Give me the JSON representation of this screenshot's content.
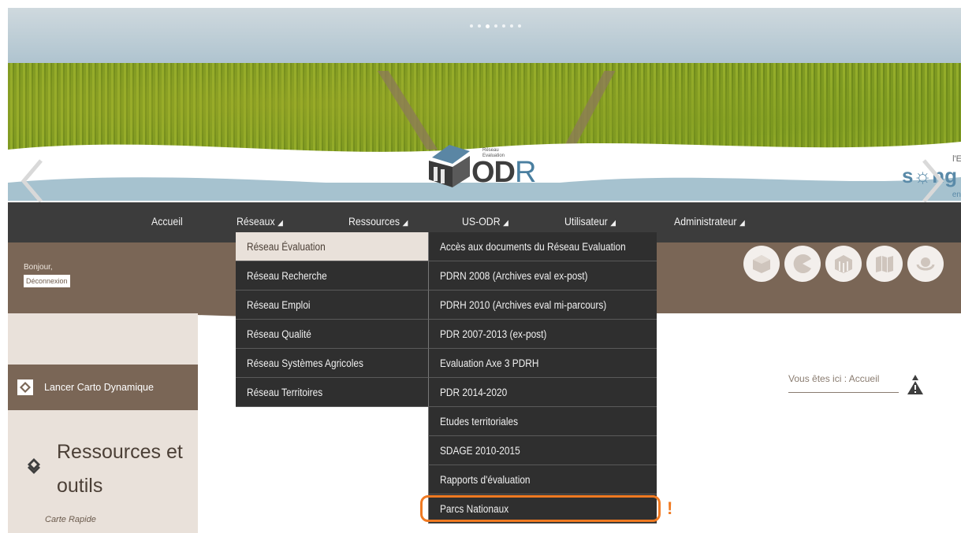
{
  "banner": {
    "slide_dots": 7,
    "active_dot": 3,
    "logo": {
      "small_line1": "Réseau",
      "small_line2": "Evaluation",
      "od": "OD",
      "r": "R"
    },
    "partner": {
      "top": "l'E",
      "main": "s☼ng",
      "sub": "en"
    }
  },
  "nav": {
    "items": [
      {
        "label": "Accueil",
        "caret": ""
      },
      {
        "label": "Réseaux",
        "caret": "◢"
      },
      {
        "label": "Ressources",
        "caret": "◢"
      },
      {
        "label": "US-ODR",
        "caret": "◢"
      },
      {
        "label": "Utilisateur",
        "caret": "◢"
      },
      {
        "label": "Administrateur",
        "caret": "◢"
      }
    ]
  },
  "user": {
    "greeting": "Bonjour,",
    "logout": "Déconnexion"
  },
  "quick_icons": [
    "box-icon",
    "pie-icon",
    "crate-icon",
    "map-icon",
    "globe-hands-icon"
  ],
  "sidebar": {
    "carto_label": "Lancer Carto Dynamique",
    "resources_title_line1": "Ressources et",
    "resources_title_line2": "outils",
    "carte_rapide": "Carte Rapide"
  },
  "breadcrumb": {
    "prefix": "Vous êtes ici :",
    "current": "Accueil"
  },
  "menus": {
    "reseaux": [
      {
        "label": "Réseau Évaluation",
        "active": true
      },
      {
        "label": "Réseau Recherche"
      },
      {
        "label": "Réseau Emploi"
      },
      {
        "label": "Réseau Qualité"
      },
      {
        "label": "Réseau Systèmes Agricoles"
      },
      {
        "label": "Réseau Territoires"
      }
    ],
    "usodr": [
      {
        "label": "Accès aux documents du Réseau Evaluation"
      },
      {
        "label": "PDRN 2008 (Archives eval ex-post)"
      },
      {
        "label": "PDRH 2010 (Archives eval mi-parcours)"
      },
      {
        "label": "PDR 2007-2013 (ex-post)"
      },
      {
        "label": "Evaluation Axe 3 PDRH"
      },
      {
        "label": "PDR 2014-2020"
      },
      {
        "label": "Etudes territoriales"
      },
      {
        "label": "SDAGE 2010-2015"
      },
      {
        "label": "Rapports d'évaluation"
      },
      {
        "label": "Parcs Nationaux"
      }
    ]
  },
  "annotation": {
    "mark": "!",
    "color": "#f07a22"
  }
}
